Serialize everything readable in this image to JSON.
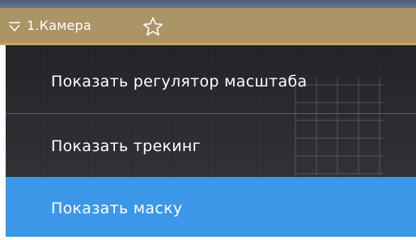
{
  "camera_header": {
    "title": "1.Камера",
    "expand_icon": "chevron-down-icon",
    "favorite_icon": "star-outline-icon",
    "colors": {
      "header_bg": "#ab9466",
      "header_border": "#c9a45d"
    }
  },
  "context_menu": {
    "items": [
      {
        "label": "Показать регулятор масштаба",
        "selected": false
      },
      {
        "label": "Показать трекинг",
        "selected": false
      },
      {
        "label": "Показать маску",
        "selected": true
      }
    ],
    "colors": {
      "menu_bg": "#2a2c30",
      "highlight": "#3c97e8",
      "text": "#ffffff"
    }
  }
}
